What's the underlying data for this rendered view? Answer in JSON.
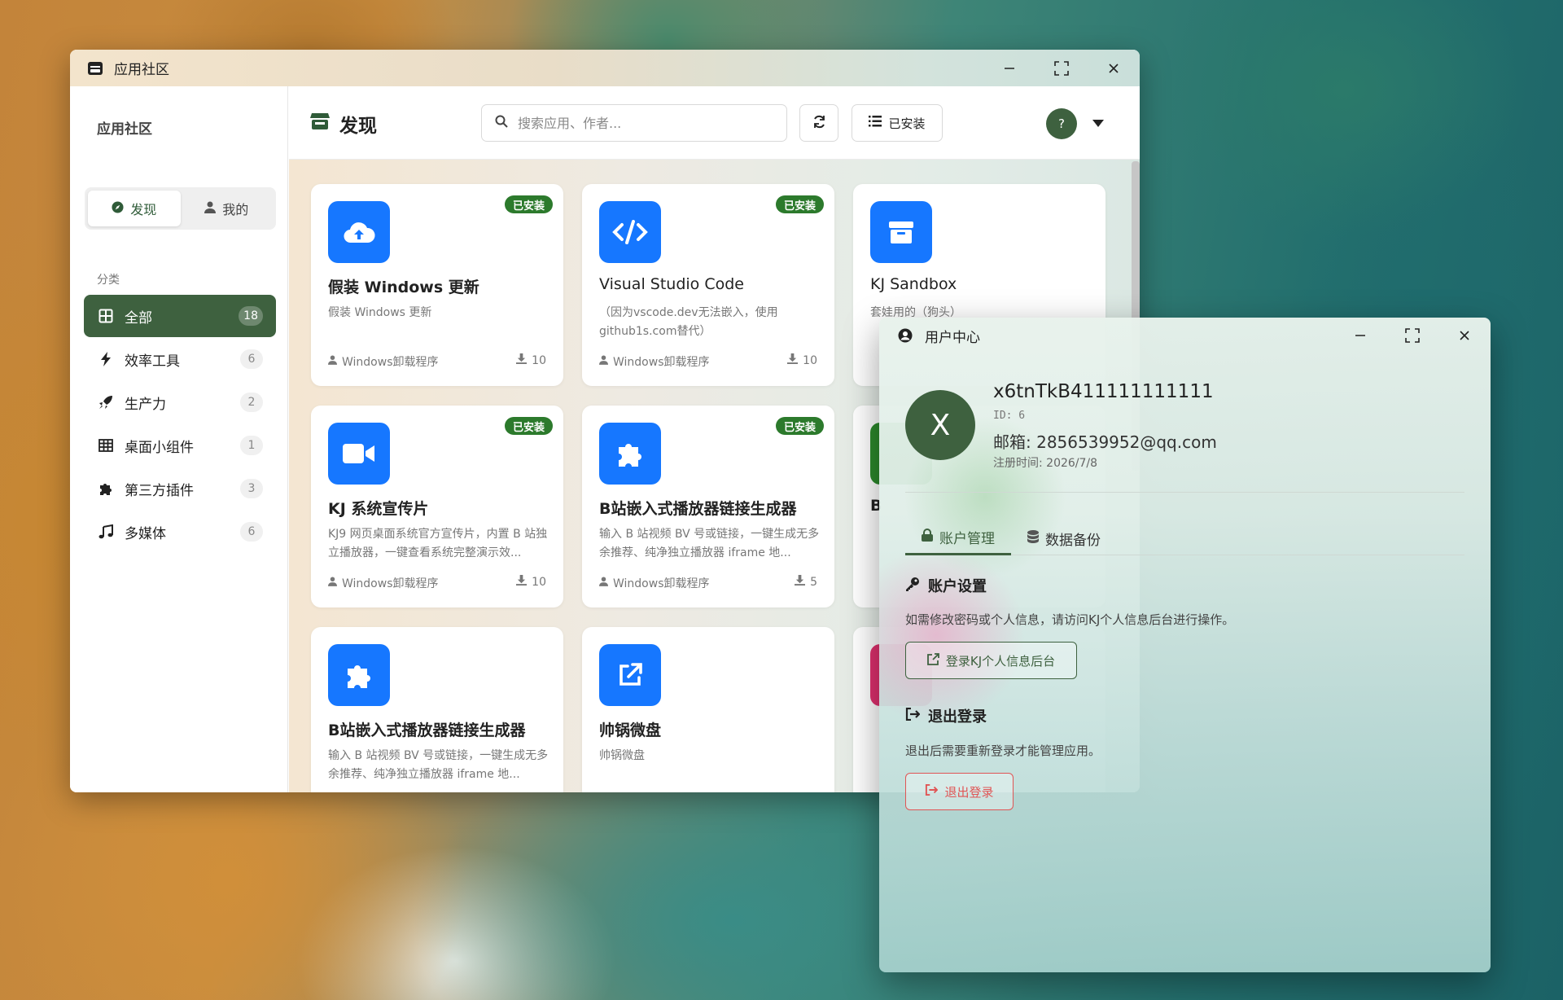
{
  "app": {
    "title": "应用社区",
    "icon": "store-icon"
  },
  "sidebar": {
    "title": "应用社区",
    "segments": [
      {
        "label": "发现",
        "icon": "compass-icon",
        "active": true
      },
      {
        "label": "我的",
        "icon": "user-icon",
        "active": false
      }
    ],
    "section_label": "分类",
    "categories": [
      {
        "label": "全部",
        "count": "18",
        "icon": "grid-icon",
        "active": true
      },
      {
        "label": "效率工具",
        "count": "6",
        "icon": "bolt-icon"
      },
      {
        "label": "生产力",
        "count": "2",
        "icon": "rocket-icon"
      },
      {
        "label": "桌面小组件",
        "count": "1",
        "icon": "table-icon"
      },
      {
        "label": "第三方插件",
        "count": "3",
        "icon": "puzzle-icon"
      },
      {
        "label": "多媒体",
        "count": "6",
        "icon": "music-icon"
      }
    ]
  },
  "header": {
    "title": "发现",
    "search_placeholder": "搜索应用、作者...",
    "installed_label": "已安装",
    "help_label": "?"
  },
  "cards": [
    {
      "name": "假装 Windows 更新",
      "desc": "假装 Windows 更新",
      "author": "Windows卸载程序",
      "downloads": "10",
      "badge": "已安装",
      "icon": "cloud-upload-icon",
      "color": "#1677ff"
    },
    {
      "name": "Visual Studio Code",
      "desc": "（因为vscode.dev无法嵌入，使用github1s.com替代）",
      "author": "Windows卸载程序",
      "downloads": "10",
      "badge": "已安装",
      "icon": "code-icon",
      "color": "#1677ff"
    },
    {
      "name": "KJ Sandbox",
      "desc": "套娃用的（狗头）",
      "author": "",
      "downloads": "",
      "badge": "",
      "icon": "box-icon",
      "color": "#1677ff"
    },
    {
      "name": "KJ 系统宣传片",
      "desc": "KJ9 网页桌面系统官方宣传片，内置 B 站独立播放器，一键查看系统完整演示效...",
      "author": "Windows卸载程序",
      "downloads": "10",
      "badge": "已安装",
      "icon": "video-icon",
      "color": "#1677ff"
    },
    {
      "name": "B站嵌入式播放器链接生成器",
      "desc": "输入 B 站视频 BV 号或链接，一键生成无多余推荐、纯净独立播放器 iframe 地...",
      "author": "Windows卸载程序",
      "downloads": "5",
      "badge": "已安装",
      "icon": "puzzle-icon",
      "color": "#1677ff"
    },
    {
      "name": "B",
      "desc": "",
      "author": "",
      "downloads": "",
      "badge": "",
      "icon": "green-tile-icon",
      "color": "#2c8a2c"
    },
    {
      "name": "B站嵌入式播放器链接生成器",
      "desc": "输入 B 站视频 BV 号或链接，一键生成无多余推荐、纯净独立播放器 iframe 地...",
      "author": "",
      "downloads": "",
      "badge": "",
      "icon": "puzzle-icon",
      "color": "#1677ff"
    },
    {
      "name": "帅锅微盘",
      "desc": "帅锅微盘",
      "author": "",
      "downloads": "",
      "badge": "",
      "icon": "external-link-icon",
      "color": "#1677ff"
    },
    {
      "name": "",
      "desc": "",
      "author": "",
      "downloads": "",
      "badge": "",
      "icon": "pink-tile-icon",
      "color": "#e0306e"
    }
  ],
  "user_center": {
    "title": "用户中心",
    "avatar_letter": "X",
    "username": "x6tnTkB411111111111",
    "id": "ID: 6",
    "email": "邮箱: 2856539952@qq.com",
    "registered": "注册时间: 2026/7/8",
    "tabs": [
      {
        "label": "账户管理",
        "icon": "lock-icon",
        "active": true
      },
      {
        "label": "数据备份",
        "icon": "database-icon",
        "active": false
      }
    ],
    "account_settings": {
      "title": "账户设置",
      "text": "如需修改密码或个人信息，请访问KJ个人信息后台进行操作。",
      "button": "登录KJ个人信息后台"
    },
    "logout": {
      "title": "退出登录",
      "text": "退出后需要重新登录才能管理应用。",
      "button": "退出登录"
    }
  },
  "colors": {
    "accent_green": "#3e613f",
    "icon_blue": "#1677ff",
    "badge_green": "#2c7a2c",
    "danger_red": "#e05555"
  }
}
